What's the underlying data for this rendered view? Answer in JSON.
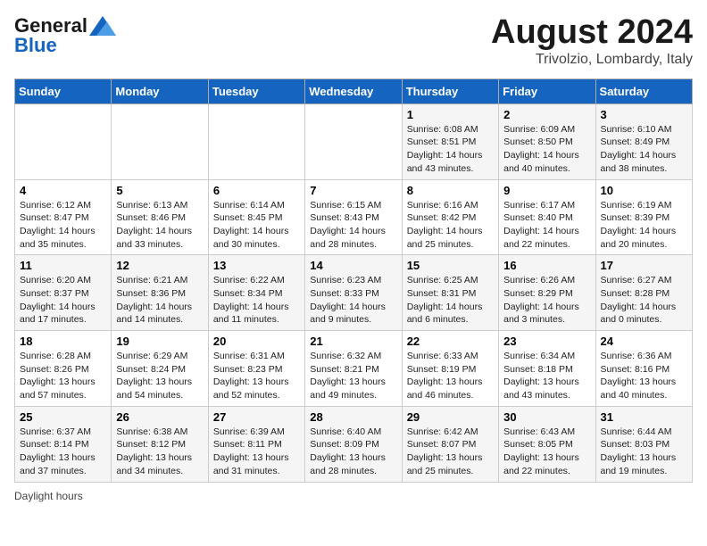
{
  "header": {
    "logo_general": "General",
    "logo_blue": "Blue",
    "main_title": "August 2024",
    "subtitle": "Trivolzio, Lombardy, Italy"
  },
  "days_of_week": [
    "Sunday",
    "Monday",
    "Tuesday",
    "Wednesday",
    "Thursday",
    "Friday",
    "Saturday"
  ],
  "weeks": [
    [
      {
        "day": "",
        "info": ""
      },
      {
        "day": "",
        "info": ""
      },
      {
        "day": "",
        "info": ""
      },
      {
        "day": "",
        "info": ""
      },
      {
        "day": "1",
        "info": "Sunrise: 6:08 AM\nSunset: 8:51 PM\nDaylight: 14 hours and 43 minutes."
      },
      {
        "day": "2",
        "info": "Sunrise: 6:09 AM\nSunset: 8:50 PM\nDaylight: 14 hours and 40 minutes."
      },
      {
        "day": "3",
        "info": "Sunrise: 6:10 AM\nSunset: 8:49 PM\nDaylight: 14 hours and 38 minutes."
      }
    ],
    [
      {
        "day": "4",
        "info": "Sunrise: 6:12 AM\nSunset: 8:47 PM\nDaylight: 14 hours and 35 minutes."
      },
      {
        "day": "5",
        "info": "Sunrise: 6:13 AM\nSunset: 8:46 PM\nDaylight: 14 hours and 33 minutes."
      },
      {
        "day": "6",
        "info": "Sunrise: 6:14 AM\nSunset: 8:45 PM\nDaylight: 14 hours and 30 minutes."
      },
      {
        "day": "7",
        "info": "Sunrise: 6:15 AM\nSunset: 8:43 PM\nDaylight: 14 hours and 28 minutes."
      },
      {
        "day": "8",
        "info": "Sunrise: 6:16 AM\nSunset: 8:42 PM\nDaylight: 14 hours and 25 minutes."
      },
      {
        "day": "9",
        "info": "Sunrise: 6:17 AM\nSunset: 8:40 PM\nDaylight: 14 hours and 22 minutes."
      },
      {
        "day": "10",
        "info": "Sunrise: 6:19 AM\nSunset: 8:39 PM\nDaylight: 14 hours and 20 minutes."
      }
    ],
    [
      {
        "day": "11",
        "info": "Sunrise: 6:20 AM\nSunset: 8:37 PM\nDaylight: 14 hours and 17 minutes."
      },
      {
        "day": "12",
        "info": "Sunrise: 6:21 AM\nSunset: 8:36 PM\nDaylight: 14 hours and 14 minutes."
      },
      {
        "day": "13",
        "info": "Sunrise: 6:22 AM\nSunset: 8:34 PM\nDaylight: 14 hours and 11 minutes."
      },
      {
        "day": "14",
        "info": "Sunrise: 6:23 AM\nSunset: 8:33 PM\nDaylight: 14 hours and 9 minutes."
      },
      {
        "day": "15",
        "info": "Sunrise: 6:25 AM\nSunset: 8:31 PM\nDaylight: 14 hours and 6 minutes."
      },
      {
        "day": "16",
        "info": "Sunrise: 6:26 AM\nSunset: 8:29 PM\nDaylight: 14 hours and 3 minutes."
      },
      {
        "day": "17",
        "info": "Sunrise: 6:27 AM\nSunset: 8:28 PM\nDaylight: 14 hours and 0 minutes."
      }
    ],
    [
      {
        "day": "18",
        "info": "Sunrise: 6:28 AM\nSunset: 8:26 PM\nDaylight: 13 hours and 57 minutes."
      },
      {
        "day": "19",
        "info": "Sunrise: 6:29 AM\nSunset: 8:24 PM\nDaylight: 13 hours and 54 minutes."
      },
      {
        "day": "20",
        "info": "Sunrise: 6:31 AM\nSunset: 8:23 PM\nDaylight: 13 hours and 52 minutes."
      },
      {
        "day": "21",
        "info": "Sunrise: 6:32 AM\nSunset: 8:21 PM\nDaylight: 13 hours and 49 minutes."
      },
      {
        "day": "22",
        "info": "Sunrise: 6:33 AM\nSunset: 8:19 PM\nDaylight: 13 hours and 46 minutes."
      },
      {
        "day": "23",
        "info": "Sunrise: 6:34 AM\nSunset: 8:18 PM\nDaylight: 13 hours and 43 minutes."
      },
      {
        "day": "24",
        "info": "Sunrise: 6:36 AM\nSunset: 8:16 PM\nDaylight: 13 hours and 40 minutes."
      }
    ],
    [
      {
        "day": "25",
        "info": "Sunrise: 6:37 AM\nSunset: 8:14 PM\nDaylight: 13 hours and 37 minutes."
      },
      {
        "day": "26",
        "info": "Sunrise: 6:38 AM\nSunset: 8:12 PM\nDaylight: 13 hours and 34 minutes."
      },
      {
        "day": "27",
        "info": "Sunrise: 6:39 AM\nSunset: 8:11 PM\nDaylight: 13 hours and 31 minutes."
      },
      {
        "day": "28",
        "info": "Sunrise: 6:40 AM\nSunset: 8:09 PM\nDaylight: 13 hours and 28 minutes."
      },
      {
        "day": "29",
        "info": "Sunrise: 6:42 AM\nSunset: 8:07 PM\nDaylight: 13 hours and 25 minutes."
      },
      {
        "day": "30",
        "info": "Sunrise: 6:43 AM\nSunset: 8:05 PM\nDaylight: 13 hours and 22 minutes."
      },
      {
        "day": "31",
        "info": "Sunrise: 6:44 AM\nSunset: 8:03 PM\nDaylight: 13 hours and 19 minutes."
      }
    ]
  ],
  "footer": {
    "note": "Daylight hours"
  }
}
